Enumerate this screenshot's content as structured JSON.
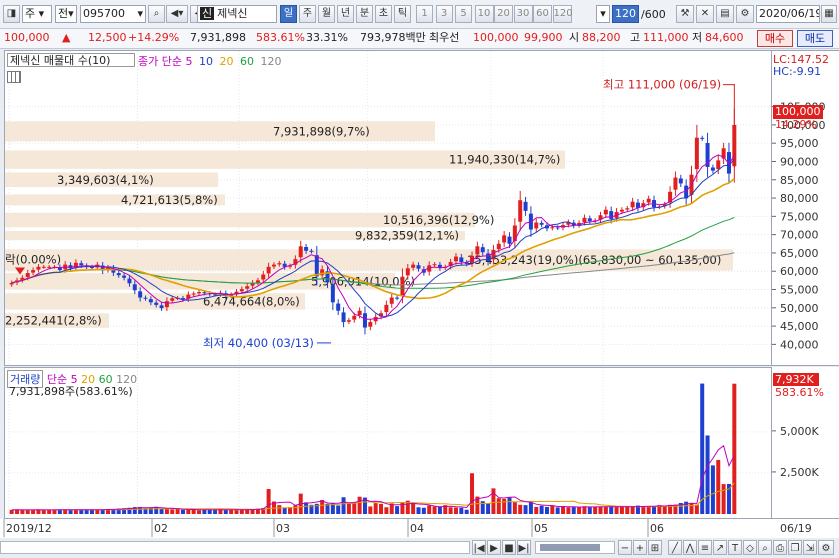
{
  "toolbar": {
    "market": "주",
    "period_label": "전",
    "code": "095700",
    "badge": "신",
    "name": "제넥신",
    "tabs": [
      "일",
      "주",
      "월",
      "년",
      "분",
      "초",
      "틱"
    ],
    "numbers": [
      "1",
      "3",
      "5",
      "10",
      "20",
      "30",
      "60",
      "120"
    ],
    "count_value": "120",
    "count_total": "/600",
    "date": "2020/06/19"
  },
  "quote": {
    "price": "100,000",
    "change": "12,500",
    "change_rate": "+14.29%",
    "volume": "7,931,898",
    "volume_rate": "583.61%",
    "turnover": "33.31%",
    "amount": "793,978백만",
    "ask_label": "최우선",
    "ask": "100,000",
    "bid": "99,900",
    "open_label": "시",
    "open": "88,200",
    "high_label": "고",
    "high": "111,000",
    "low_label": "저",
    "low": "84,600",
    "buy": "매수",
    "sell": "매도"
  },
  "price_panel": {
    "title": "제넥신 매물대 수(10)",
    "ma_label": "종가 단순",
    "ma_periods": [
      "5",
      "10",
      "20",
      "60",
      "120"
    ],
    "lc": "LC:147.52",
    "hc": "HC:-9.91",
    "current_price": "100,000",
    "current_rate": "14.29%",
    "high_note": "최고 111,000 (06/19)",
    "low_note": "최저 40,400 (03/13)",
    "start_note": "락(0.00%)",
    "range_note": "15,453,243(19.0%)(65,830.00 ~ 60,135.00)"
  },
  "vol_panel": {
    "title": "거래량",
    "ma_label": "단순",
    "ma_periods": [
      "5",
      "20",
      "60",
      "120"
    ],
    "volume_text": "7,931,898주(583.61%)",
    "current_volume": "7,932K",
    "current_rate": "583.61%"
  },
  "colors": {
    "up": "#e0201e",
    "down": "#1e3fd0",
    "ma5": "#c000c0",
    "ma10": "#1f3fbf",
    "ma20": "#e0a000",
    "ma60": "#20a040",
    "ma120": "#888888",
    "profile": "#f4e4d2"
  },
  "chart_data": [
    {
      "type": "candlestick",
      "title": "제넥신 매물대 수(10)",
      "x_start": "2019/12",
      "x_end": "06/19",
      "x_ticks": [
        "2019/12",
        "02",
        "03",
        "04",
        "05",
        "06",
        "06/19"
      ],
      "y_ticks": [
        40000,
        45000,
        50000,
        55000,
        60000,
        65000,
        70000,
        75000,
        80000,
        85000,
        90000,
        95000,
        100000,
        105000
      ],
      "ylim": [
        36000,
        112000
      ],
      "close": [
        56800,
        57500,
        58200,
        59500,
        60300,
        61200,
        61200,
        61200,
        61200,
        60300,
        61800,
        60800,
        62300,
        61600,
        61200,
        60900,
        61800,
        60200,
        61000,
        59600,
        58900,
        58200,
        56700,
        54800,
        52800,
        52500,
        51500,
        50800,
        49900,
        51800,
        52600,
        52700,
        52300,
        53600,
        53900,
        54300,
        54000,
        53700,
        53600,
        54100,
        53200,
        53600,
        54400,
        55100,
        55900,
        56800,
        57500,
        59100,
        61200,
        61800,
        62200,
        61200,
        61500,
        63300,
        66800,
        65600,
        65400,
        58600,
        60500,
        57000,
        51500,
        49200,
        46100,
        46600,
        47800,
        49200,
        44600,
        46100,
        47500,
        48500,
        50800,
        52800,
        52600,
        58500,
        60800,
        61800,
        60700,
        59600,
        61600,
        61900,
        60900,
        61200,
        62500,
        64000,
        62500,
        62000,
        64200,
        66800,
        65200,
        62800,
        65800,
        67500,
        69800,
        67500,
        72500,
        79400,
        76500,
        71400,
        73300,
        72700,
        71700,
        72000,
        71800,
        72600,
        73400,
        72500,
        73200,
        74600,
        73700,
        73900,
        75300,
        76800,
        74300,
        76200,
        76800,
        77200,
        79000,
        77300,
        78600,
        79800,
        77500,
        77700,
        78300,
        81700,
        85600,
        84000,
        79900,
        86400,
        96500,
        96200,
        88500,
        87500,
        90300,
        93600,
        86700,
        100000
      ],
      "ma_periods": [
        5,
        10,
        20,
        60,
        120
      ],
      "volume_panel": {
        "title": "거래량",
        "y_ticks": [
          "2,500K",
          "5,000K"
        ],
        "last_volume_k": 7932,
        "volume_k": [
          250,
          260,
          230,
          270,
          250,
          260,
          230,
          240,
          260,
          280,
          280,
          230,
          270,
          250,
          250,
          270,
          260,
          280,
          300,
          290,
          330,
          350,
          380,
          420,
          430,
          350,
          380,
          440,
          330,
          300,
          280,
          300,
          250,
          260,
          270,
          230,
          260,
          270,
          240,
          300,
          240,
          260,
          230,
          260,
          310,
          280,
          330,
          360,
          1520,
          760,
          540,
          380,
          410,
          520,
          1240,
          710,
          560,
          620,
          850,
          620,
          640,
          520,
          1020,
          640,
          680,
          1050,
          1000,
          460,
          660,
          610,
          410,
          640,
          480,
          710,
          810,
          640,
          410,
          380,
          520,
          450,
          430,
          540,
          410,
          390,
          380,
          260,
          2480,
          1060,
          780,
          640,
          1560,
          960,
          920,
          1020,
          720,
          560,
          540,
          720,
          430,
          500,
          430,
          520,
          400,
          430,
          410,
          420,
          430,
          470,
          420,
          430,
          450,
          460,
          470,
          420,
          430,
          440,
          470,
          510,
          440,
          470,
          490,
          540,
          500,
          560,
          570,
          670,
          750,
          680,
          570,
          7940,
          4780,
          2960,
          3290,
          1820,
          1830,
          7932
        ]
      },
      "volume_profile": [
        "7,931,898(9,7%)",
        "11,940,330(14,7%)",
        "3,349,603(4,1%)",
        "4,721,613(5,8%)",
        "10,516,396(12,9%)",
        "9,832,359(12,1%)",
        "15,453,243(19,0%)(65,830,00 ~ 60,135,00)",
        "5,906,914(10,0%)",
        "6,474,664(8,0%)",
        "2,252,441(2,8%)"
      ]
    }
  ]
}
